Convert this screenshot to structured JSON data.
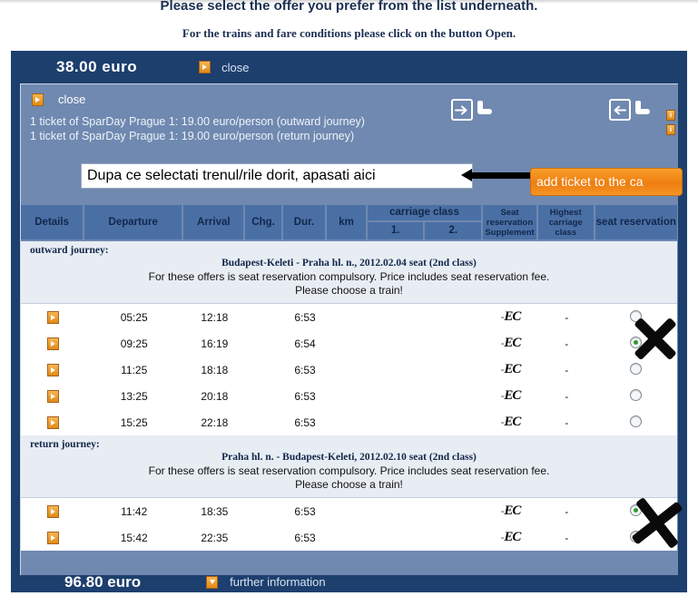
{
  "intro": {
    "line1": "Please select the offer you prefer from the list underneath.",
    "line2": "For the trains and fare conditions please click on the button Open."
  },
  "panel": {
    "header": {
      "price": "38.00 euro",
      "close_label": "close"
    },
    "footer": {
      "price": "96.80 euro",
      "more_label": "further information"
    }
  },
  "inner": {
    "close_label": "close",
    "ticket_lines": [
      "1 ticket of SparDay Prague 1: 19.00 euro/person (outward journey)",
      "1 ticket of SparDay Prague 1: 19.00 euro/person (return journey)"
    ],
    "info_badges": [
      "i",
      "i"
    ]
  },
  "annotation": {
    "text": "Dupa ce selectati trenul/rile dorit, apasati aici",
    "arrow": "right-arrow-annotation"
  },
  "add_button": {
    "label": "add ticket to the ca"
  },
  "table": {
    "headers": {
      "details": "Details",
      "departure": "Departure",
      "arrival": "Arrival",
      "chg": "Chg.",
      "dur": "Dur.",
      "km": "km",
      "carriage_class": "carriage class",
      "class_1": "1.",
      "class_2": "2.",
      "seat_reservation_supplement": "Seat reservation Supplement",
      "highest_carriage_class": "Highest carriage class",
      "seat_reservation": "seat reservation"
    },
    "sections": [
      {
        "label": "outward journey:",
        "title": "Budapest-Keleti - Praha hl. n., 2012.02.04 seat (2nd class)",
        "note_line1": "For these offers is seat reservation compulsory. Price includes seat reservation fee.",
        "note_line2": "Please choose a train!",
        "rows": [
          {
            "departure": "05:25",
            "arrival": "12:18",
            "chg": "",
            "dur": "6:53",
            "km": "",
            "class1": "",
            "class2": "-",
            "supplement": "EC",
            "highest": "-",
            "selected": false
          },
          {
            "departure": "09:25",
            "arrival": "16:19",
            "chg": "",
            "dur": "6:54",
            "km": "",
            "class1": "",
            "class2": "-",
            "supplement": "EC",
            "highest": "-",
            "selected": true
          },
          {
            "departure": "11:25",
            "arrival": "18:18",
            "chg": "",
            "dur": "6:53",
            "km": "",
            "class1": "",
            "class2": "-",
            "supplement": "EC",
            "highest": "-",
            "selected": false
          },
          {
            "departure": "13:25",
            "arrival": "20:18",
            "chg": "",
            "dur": "6:53",
            "km": "",
            "class1": "",
            "class2": "-",
            "supplement": "EC",
            "highest": "-",
            "selected": false
          },
          {
            "departure": "15:25",
            "arrival": "22:18",
            "chg": "",
            "dur": "6:53",
            "km": "",
            "class1": "",
            "class2": "-",
            "supplement": "EC",
            "highest": "-",
            "selected": false
          }
        ]
      },
      {
        "label": "return journey:",
        "title": "Praha hl. n. - Budapest-Keleti, 2012.02.10 seat (2nd class)",
        "note_line1": "For these offers is seat reservation compulsory. Price includes seat reservation fee.",
        "note_line2": "Please choose a train!",
        "rows": [
          {
            "departure": "11:42",
            "arrival": "18:35",
            "chg": "",
            "dur": "6:53",
            "km": "",
            "class1": "",
            "class2": "-",
            "supplement": "EC",
            "highest": "-",
            "selected": true
          },
          {
            "departure": "15:42",
            "arrival": "22:35",
            "chg": "",
            "dur": "6:53",
            "km": "",
            "class1": "",
            "class2": "-",
            "supplement": "EC",
            "highest": "-",
            "selected": false
          }
        ]
      }
    ]
  },
  "marks": [
    {
      "name": "x-mark-outward"
    },
    {
      "name": "x-mark-return"
    }
  ],
  "colors": {
    "panel_navy": "#1d3f6e",
    "inner_slate": "#7089b0",
    "header_cell": "#4a6fa5",
    "section_band": "#e8edf4",
    "accent_orange": "#ef7d10",
    "selected_green": "#2f9b2f"
  }
}
